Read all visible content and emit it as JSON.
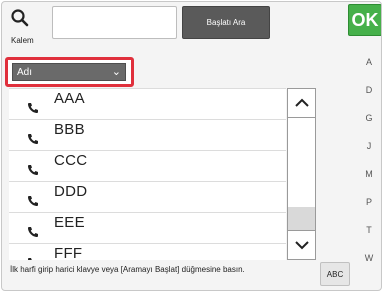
{
  "search": {
    "caption": "Kalem",
    "input_value": "",
    "start_label": "Başlatı Ara"
  },
  "ok_label": "OK",
  "dropdown": {
    "selected": "Adı"
  },
  "list": {
    "items": [
      {
        "name": "AAA"
      },
      {
        "name": "BBB"
      },
      {
        "name": "CCC"
      },
      {
        "name": "DDD"
      },
      {
        "name": "EEE"
      },
      {
        "name": "FFF"
      }
    ]
  },
  "index": [
    "A",
    "D",
    "G",
    "J",
    "M",
    "P",
    "T",
    "W"
  ],
  "hint": "İlk harfi girip harici klavye veya [Aramayı Başlat] düğmesine basın.",
  "abc_label": "ABC",
  "colors": {
    "ok": "#46b04a",
    "highlight": "#e0303c"
  },
  "icons": {
    "search": "search-icon",
    "phone": "phone-icon",
    "scroll_up": "chevron-up-icon",
    "scroll_down": "chevron-down-icon"
  }
}
